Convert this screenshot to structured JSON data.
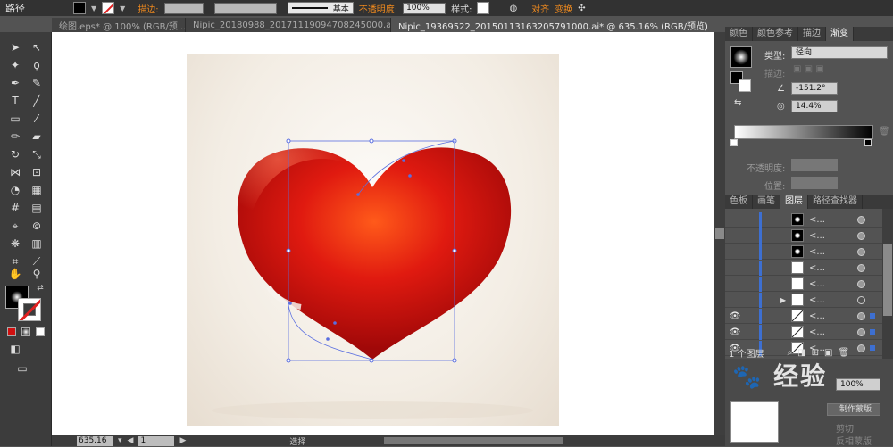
{
  "control_bar": {
    "title": "路径",
    "stroke_label": "描边:",
    "stroke_style": "基本",
    "opacity_label": "不透明度:",
    "opacity_value": "100%",
    "style_label": "样式:",
    "align_label": "对齐",
    "transform_label": "变换"
  },
  "tabs": [
    {
      "label": "绘图.eps* @ 100% (RGB/预..."
    },
    {
      "label": "Nipic_20180988_20171119094708245000.ai*"
    },
    {
      "label": "Nipic_19369522_20150113163205791000.ai* @ 635.16% (RGB/预览)"
    }
  ],
  "gradient_panel": {
    "tabs": [
      "颜色",
      "颜色参考",
      "描边",
      "渐变"
    ],
    "type_label": "类型:",
    "type_value": "径向",
    "stroke_label": "描边:",
    "angle_value": "-151.2°",
    "aspect_value": "14.4%",
    "opacity_label": "不透明度:",
    "position_label": "位置:"
  },
  "layers_panel": {
    "tabs": [
      "色板",
      "画笔",
      "图层",
      "路径查找器"
    ],
    "rows": [
      {
        "name": "<..."
      },
      {
        "name": "<..."
      },
      {
        "name": "<..."
      },
      {
        "name": "<..."
      },
      {
        "name": "<..."
      },
      {
        "name": "<..."
      },
      {
        "name": "<..."
      },
      {
        "name": "<..."
      },
      {
        "name": "<..."
      }
    ],
    "footer_label": "1 个图层"
  },
  "transparency_panel": {
    "opacity_value": "100%",
    "make_mask_label": "制作蒙版",
    "clip_label": "剪切",
    "invert_label": "反相蒙版"
  },
  "status_bar": {
    "zoom": "635.16",
    "page": "1",
    "mode": "选择"
  },
  "watermark": "经验",
  "colors": {
    "accent_orange": "#f08a1e",
    "heart_red": "#d41010",
    "selection_blue": "#5a6ee0"
  }
}
